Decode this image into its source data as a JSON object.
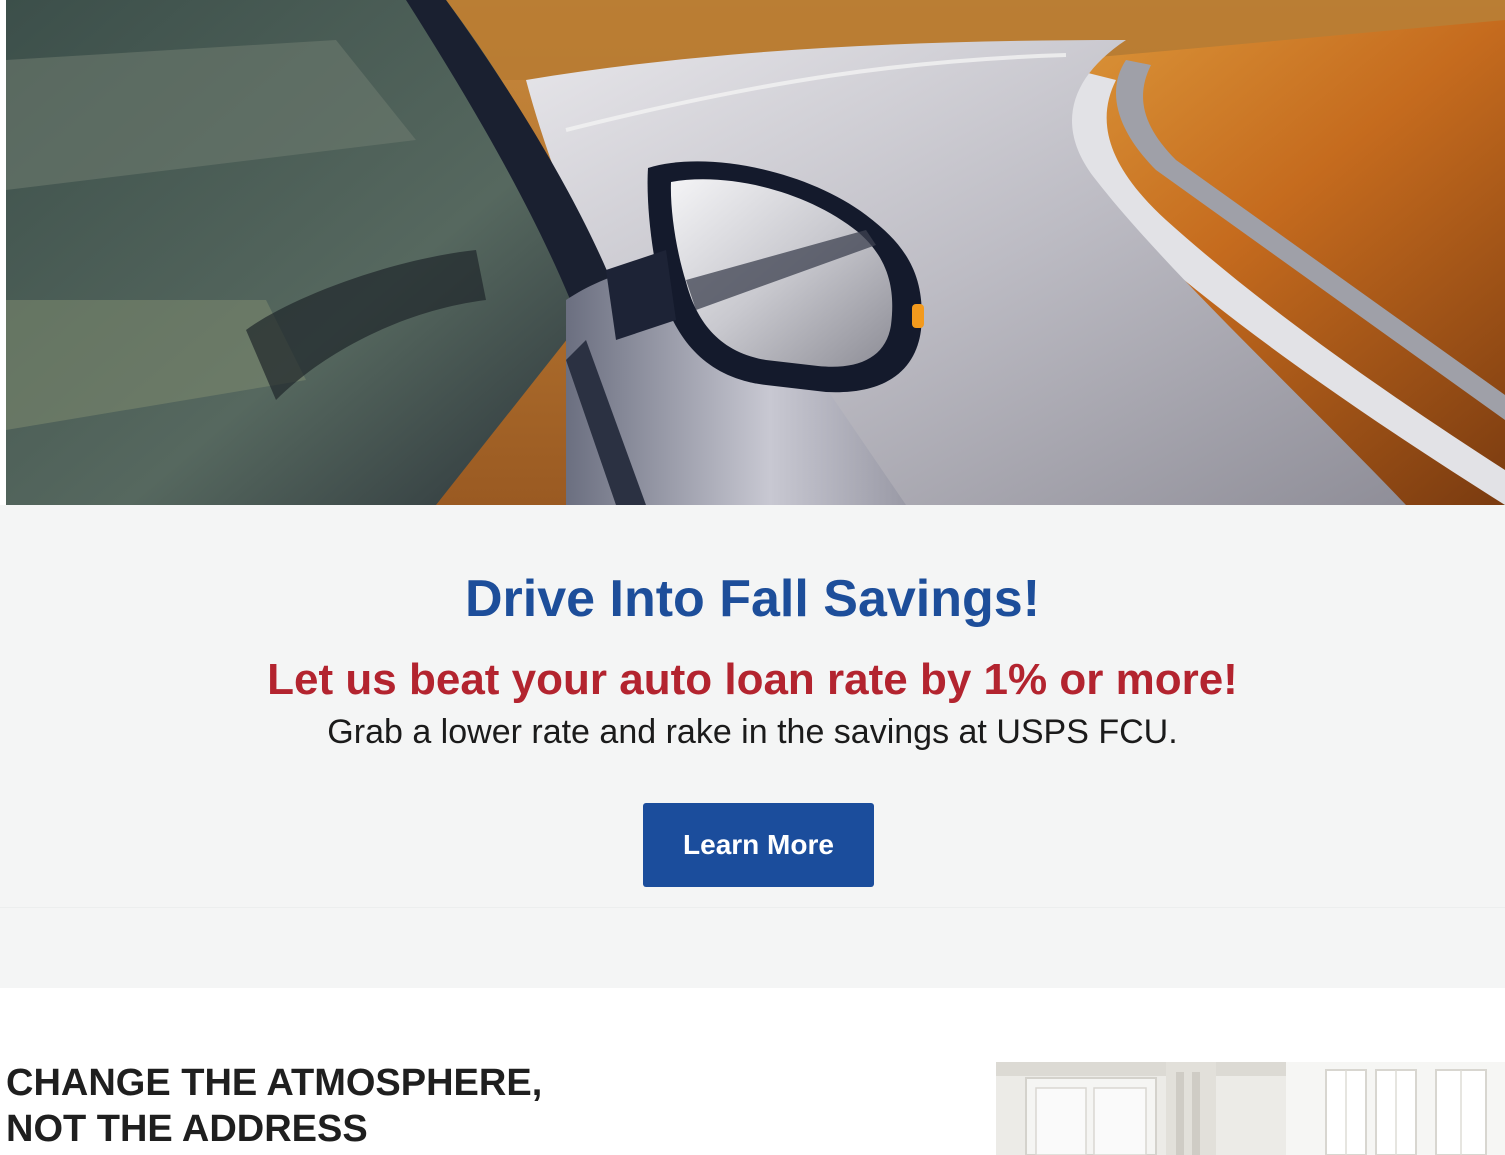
{
  "hero": {
    "image_name": "car-side-mirror-autumn-road-image"
  },
  "promo": {
    "title": "Drive Into Fall Savings!",
    "subtitle": "Let us beat your auto loan rate by 1% or more!",
    "body": "Grab a lower rate and rake in the savings at USPS FCU.",
    "button_label": "Learn More"
  },
  "section2": {
    "heading_line1": "CHANGE THE ATMOSPHERE,",
    "heading_line2": "NOT THE ADDRESS",
    "image_name": "white-room-interior-image"
  },
  "colors": {
    "title_blue": "#1d4e9a",
    "subtitle_red": "#b3242f",
    "button_blue": "#1b4d9c",
    "panel_bg": "#f4f5f5"
  }
}
